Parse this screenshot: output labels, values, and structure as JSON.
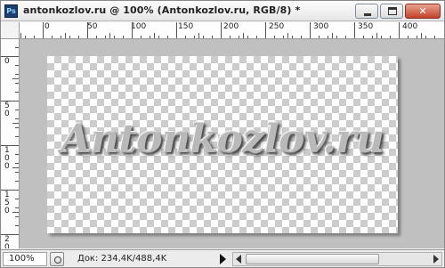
{
  "window": {
    "title": "antonkozlov.ru @ 100% (Antonkozlov.ru, RGB/8) *",
    "app_icon_label": "Ps",
    "controls": {
      "minimize_icon": "minimize-icon",
      "maximize_icon": "maximize-icon",
      "close_label": "✕"
    }
  },
  "rulers": {
    "top_labels": [
      "0",
      "50",
      "100",
      "150",
      "200",
      "250",
      "300",
      "350",
      "400"
    ],
    "left_labels": [
      "0",
      "5 0",
      "1 0 0",
      "1 5 0",
      "2 0"
    ]
  },
  "canvas": {
    "text": "Antonkozlov.ru",
    "background": "transparency-checkerboard"
  },
  "statusbar": {
    "zoom_value": "100%",
    "doc_info": "Док: 234,4K/488,4K"
  }
}
